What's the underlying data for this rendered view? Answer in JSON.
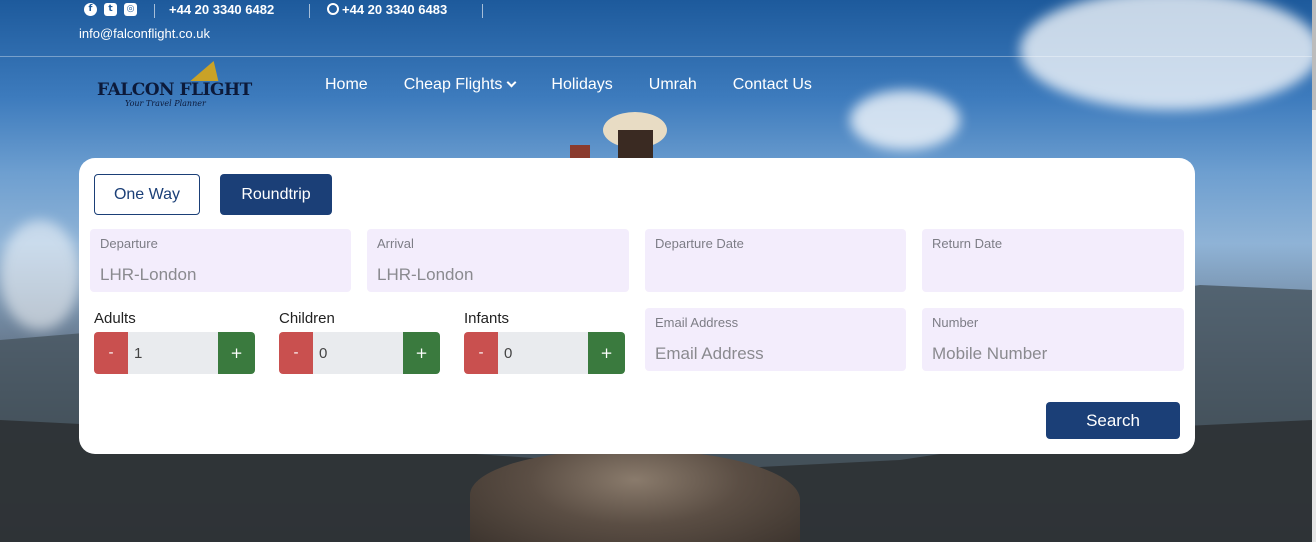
{
  "topbar": {
    "phone_1": "+44 20 3340 6482",
    "phone_2": "+44 20 3340 6483",
    "email": "info@falconflight.co.uk",
    "social_icons": [
      "facebook-icon",
      "twitter-icon",
      "instagram-icon"
    ]
  },
  "brand": {
    "name": "FALCON FLIGHT",
    "tagline": "Your Travel Planner",
    "accent": "#c9a227"
  },
  "nav": {
    "items": [
      {
        "label": "Home"
      },
      {
        "label": "Cheap Flights",
        "has_dropdown": true
      },
      {
        "label": "Holidays"
      },
      {
        "label": "Umrah"
      },
      {
        "label": "Contact Us"
      }
    ]
  },
  "search_form": {
    "trip_types": {
      "one_way": "One Way",
      "roundtrip": "Roundtrip",
      "selected": "Roundtrip"
    },
    "departure": {
      "label": "Departure",
      "value": "LHR-London"
    },
    "arrival": {
      "label": "Arrival",
      "value": "LHR-London"
    },
    "departure_date": {
      "label": "Departure Date",
      "value": ""
    },
    "return_date": {
      "label": "Return Date",
      "value": ""
    },
    "email": {
      "label": "Email Address",
      "placeholder": "Email Address"
    },
    "number": {
      "label": "Number",
      "placeholder": "Mobile Number"
    },
    "adults": {
      "label": "Adults",
      "value": "1"
    },
    "children": {
      "label": "Children",
      "value": "0"
    },
    "infants": {
      "label": "Infants",
      "value": "0"
    },
    "minus": "-",
    "plus": "+",
    "search_label": "Search"
  },
  "colors": {
    "primary": "#1b3f77",
    "field_bg": "#f3edfc",
    "minus": "#c9504f",
    "plus": "#3a7a3e"
  }
}
